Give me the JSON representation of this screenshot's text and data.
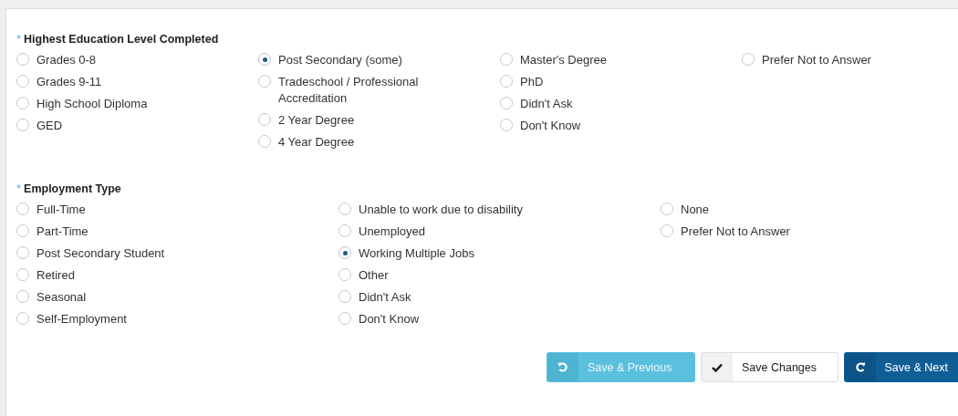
{
  "sections": [
    {
      "heading": "Highest Education Level Completed",
      "required": "*",
      "columns": [
        [
          {
            "label": "Grades 0-8",
            "selected": false
          },
          {
            "label": "Grades 9-11",
            "selected": false
          },
          {
            "label": "High School Diploma",
            "selected": false
          },
          {
            "label": "GED",
            "selected": false
          }
        ],
        [
          {
            "label": "Post Secondary (some)",
            "selected": true
          },
          {
            "label": "Tradeschool / Professional Accreditation",
            "selected": false
          },
          {
            "label": "2 Year Degree",
            "selected": false
          },
          {
            "label": "4 Year Degree",
            "selected": false
          }
        ],
        [
          {
            "label": "Master's Degree",
            "selected": false
          },
          {
            "label": "PhD",
            "selected": false
          },
          {
            "label": "Didn't Ask",
            "selected": false
          },
          {
            "label": "Don't Know",
            "selected": false
          }
        ],
        [
          {
            "label": "Prefer Not to Answer",
            "selected": false
          }
        ]
      ]
    },
    {
      "heading": "Employment Type",
      "required": "*",
      "columns": [
        [
          {
            "label": "Full-Time",
            "selected": false
          },
          {
            "label": "Part-Time",
            "selected": false
          },
          {
            "label": "Post Secondary Student",
            "selected": false
          },
          {
            "label": "Retired",
            "selected": false
          },
          {
            "label": "Seasonal",
            "selected": false
          },
          {
            "label": "Self-Employment",
            "selected": false
          }
        ],
        [
          {
            "label": "Unable to work due to disability",
            "selected": false
          },
          {
            "label": "Unemployed",
            "selected": false
          },
          {
            "label": "Working Multiple Jobs",
            "selected": true
          },
          {
            "label": "Other",
            "selected": false
          },
          {
            "label": "Didn't Ask",
            "selected": false
          },
          {
            "label": "Don't Know",
            "selected": false
          }
        ],
        [
          {
            "label": "None",
            "selected": false
          },
          {
            "label": "Prefer Not to Answer",
            "selected": false
          }
        ]
      ]
    }
  ],
  "buttons": [
    {
      "label": "Save & Previous",
      "kind": "previous"
    },
    {
      "label": "Save Changes",
      "kind": "save"
    },
    {
      "label": "Save & Next",
      "kind": "next"
    }
  ]
}
